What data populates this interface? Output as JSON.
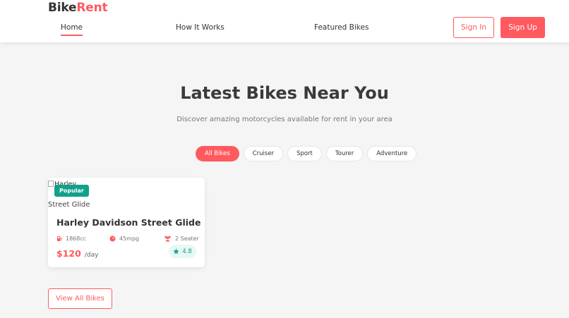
{
  "brand": {
    "part1": "Bike",
    "part2": "Rent"
  },
  "nav": {
    "home": "Home",
    "how_it_works": "How It Works",
    "featured": "Featured Bikes",
    "sign_in": "Sign In",
    "sign_up": "Sign Up"
  },
  "hero": {
    "title": "Latest Bikes Near You",
    "subtitle": "Discover amazing motorcycles available for rent in your area"
  },
  "filters": [
    "All Bikes",
    "Cruiser",
    "Sport",
    "Tourer",
    "Adventure"
  ],
  "active_filter": "All Bikes",
  "bike": {
    "image_alt_line1": "Harley",
    "image_alt_line2": "Street Glide",
    "badge": "Popular",
    "name": "Harley Davidson Street Glide",
    "engine": "1868cc",
    "mileage": "45mpg",
    "seats": "2 Seater",
    "price": "$120",
    "per": "/day",
    "rating": "4.8"
  },
  "view_all": "View All Bikes",
  "colors": {
    "accent": "#ff5a5f",
    "teal": "#12a08a"
  },
  "icons": {
    "engine": "fuel-pump-icon",
    "mileage": "gauge-icon",
    "seats": "users-icon",
    "rating": "star-icon"
  }
}
